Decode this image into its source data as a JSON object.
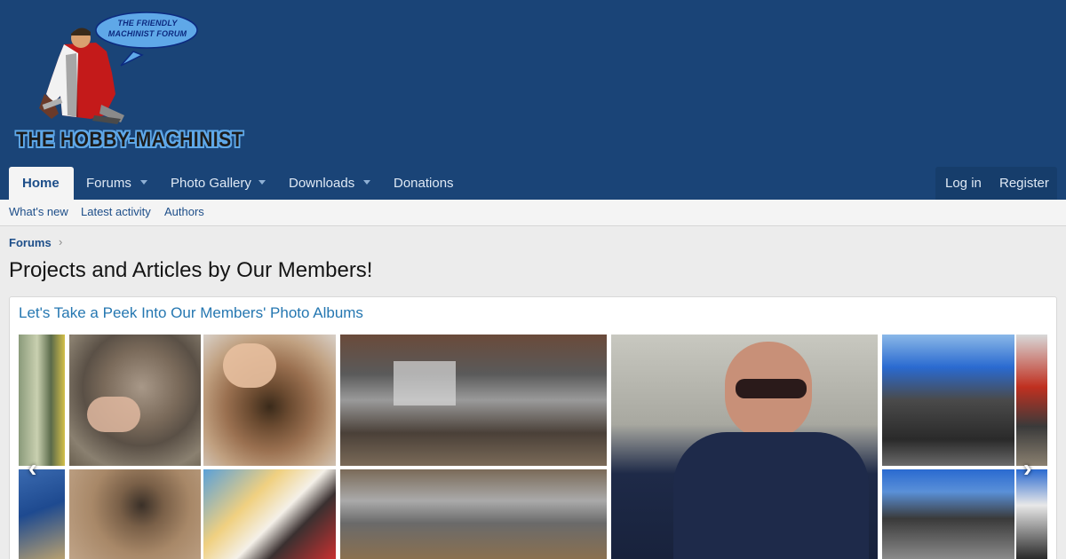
{
  "header": {
    "logo_bubble": "THE FRIENDLY MACHINIST FORUM",
    "logo_title": "THE HOBBY-MACHINIST"
  },
  "nav": {
    "tabs": [
      {
        "label": "Home"
      },
      {
        "label": "Forums"
      },
      {
        "label": "Photo Gallery"
      },
      {
        "label": "Downloads"
      },
      {
        "label": "Donations"
      }
    ],
    "login_label": "Log in",
    "register_label": "Register"
  },
  "subnav": {
    "items": [
      "What's new",
      "Latest activity",
      "Authors"
    ]
  },
  "breadcrumb": {
    "items": [
      "Forums"
    ]
  },
  "page": {
    "title": "Projects and Articles by Our Members!"
  },
  "gallery": {
    "title": "Let's Take a Peek Into Our Members' Photo Albums",
    "prev_icon": "‹",
    "next_icon": "›"
  },
  "colors": {
    "header_bg": "#1a4477",
    "link": "#2577b1",
    "nav_text": "#dfe9f5",
    "active_tab_text": "#1d4e89"
  }
}
